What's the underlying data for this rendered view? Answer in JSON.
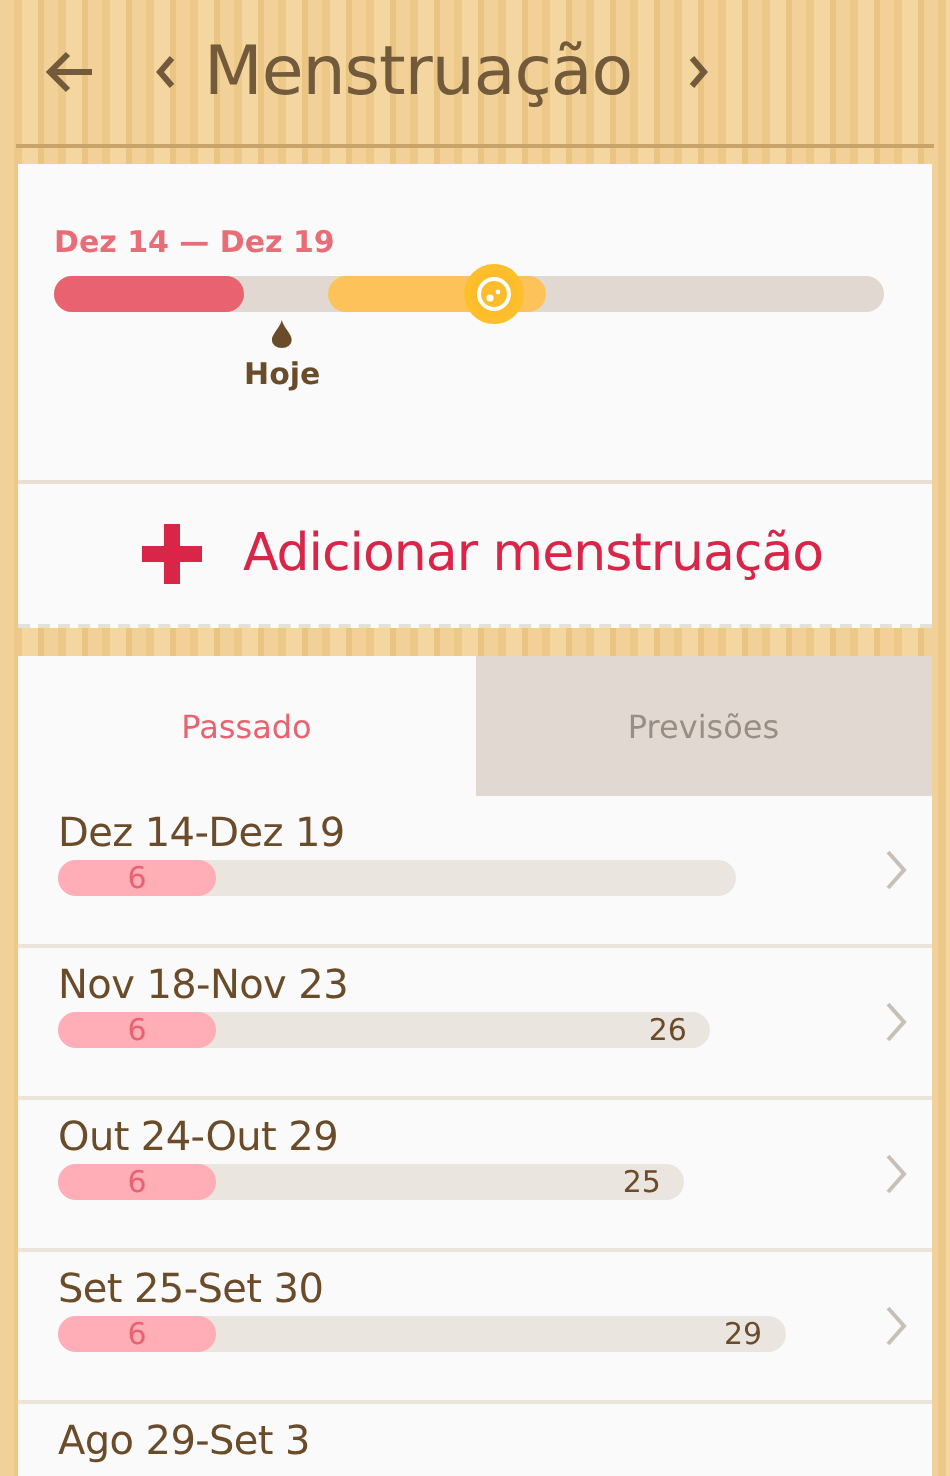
{
  "header": {
    "title": "Menstruação"
  },
  "current": {
    "dates": "Dez 14 — Dez 19",
    "period": {
      "level": 0.23
    },
    "ovulation": {
      "level": 0.53
    },
    "today": {
      "label": "Hoje",
      "level": 0.275
    }
  },
  "add_button": {
    "label": "Adicionar menstruação"
  },
  "tabs": [
    {
      "label": "Passado",
      "selected": true
    },
    {
      "label": "Previsões",
      "selected": false
    }
  ],
  "cycles": [
    {
      "dates": "Dez 14-Dez 19",
      "period_days": "6",
      "level": 0.233
    },
    {
      "dates": "Nov 18-Nov 23",
      "period_days": "6",
      "cycle_days": "26",
      "level": 0.242
    },
    {
      "dates": "Out 24-Out 29",
      "period_days": "6",
      "cycle_days": "25",
      "level": 0.252
    },
    {
      "dates": "Set 25-Set 30",
      "period_days": "6",
      "cycle_days": "29",
      "level": 0.217
    },
    {
      "dates": "Ago 29-Set 3"
    }
  ]
}
